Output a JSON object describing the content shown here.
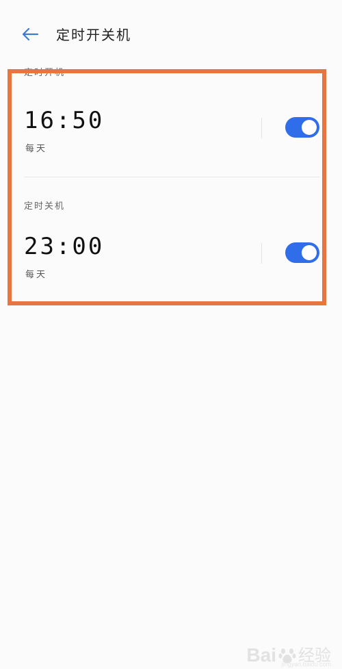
{
  "header": {
    "title": "定时开关机",
    "back_icon": "arrow-left-icon"
  },
  "schedules": [
    {
      "section_label": "定时开机",
      "time": "16:50",
      "repeat": "每天",
      "enabled": true
    },
    {
      "section_label": "定时关机",
      "time": "23:00",
      "repeat": "每天",
      "enabled": true
    }
  ],
  "colors": {
    "accent": "#2f6ee8",
    "highlight": "#e8743f",
    "back_arrow": "#3b7bd6"
  },
  "watermark": {
    "brand": "Bai",
    "brand_cn": "经验",
    "url": "jingyan.baidu.com"
  }
}
